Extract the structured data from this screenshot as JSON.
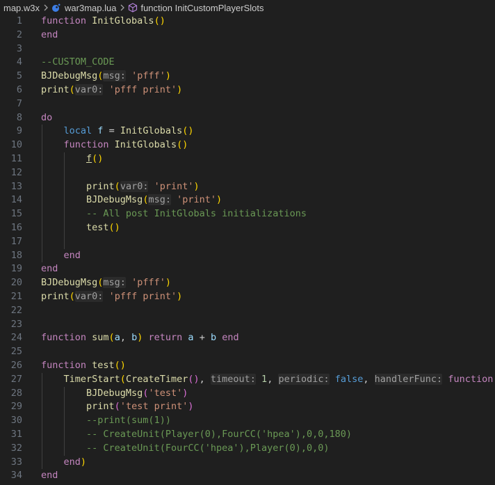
{
  "breadcrumb": {
    "folder": "map.w3x",
    "file": "war3map.lua",
    "symbol": "function InitCustomPlayerSlots"
  },
  "colors": {
    "background": "#1f1f1f",
    "keyword": "#c586c0",
    "function": "#dcdcaa",
    "string": "#ce9178",
    "comment": "#6a9955",
    "variable": "#9cdcfe",
    "number": "#b5cea8",
    "bracket1": "#ffd700",
    "bracket2": "#da70d6",
    "bracket3": "#179fff",
    "hint_bg": "#2b2b2b",
    "line_number": "#6e7681"
  },
  "lines": [
    {
      "n": "1",
      "tokens": [
        [
          "function ",
          "kw"
        ],
        [
          "InitGlobals",
          "fn"
        ],
        [
          "()",
          "b1"
        ]
      ]
    },
    {
      "n": "2",
      "tokens": [
        [
          "end",
          "kw"
        ]
      ]
    },
    {
      "n": "3",
      "tokens": []
    },
    {
      "n": "4",
      "tokens": [
        [
          "--CUSTOM_CODE",
          "cm"
        ]
      ]
    },
    {
      "n": "5",
      "tokens": [
        [
          "BJDebugMsg",
          "fn"
        ],
        [
          "(",
          "b1"
        ],
        [
          "msg:",
          "hint"
        ],
        [
          " ",
          "p"
        ],
        [
          "'pfff'",
          "str"
        ],
        [
          ")",
          "b1"
        ]
      ]
    },
    {
      "n": "6",
      "tokens": [
        [
          "print",
          "fn"
        ],
        [
          "(",
          "b1"
        ],
        [
          "var0:",
          "hint"
        ],
        [
          " ",
          "p"
        ],
        [
          "'pfff print'",
          "str"
        ],
        [
          ")",
          "b1"
        ]
      ]
    },
    {
      "n": "7",
      "tokens": []
    },
    {
      "n": "8",
      "tokens": [
        [
          "do",
          "kw"
        ]
      ]
    },
    {
      "n": "9",
      "tokens": [
        [
          "    ",
          "p"
        ],
        [
          "local ",
          "kw2"
        ],
        [
          "f",
          "var"
        ],
        [
          " = ",
          "p"
        ],
        [
          "InitGlobals",
          "fn"
        ],
        [
          "()",
          "b1"
        ]
      ]
    },
    {
      "n": "10",
      "tokens": [
        [
          "    ",
          "p"
        ],
        [
          "function ",
          "kw"
        ],
        [
          "InitGlobals",
          "fn"
        ],
        [
          "()",
          "b1"
        ]
      ]
    },
    {
      "n": "11",
      "tokens": [
        [
          "        ",
          "p"
        ],
        [
          "f",
          "fnu"
        ],
        [
          "()",
          "b1"
        ]
      ]
    },
    {
      "n": "12",
      "tokens": []
    },
    {
      "n": "13",
      "tokens": [
        [
          "        ",
          "p"
        ],
        [
          "print",
          "fn"
        ],
        [
          "(",
          "b1"
        ],
        [
          "var0:",
          "hint"
        ],
        [
          " ",
          "p"
        ],
        [
          "'print'",
          "str"
        ],
        [
          ")",
          "b1"
        ]
      ]
    },
    {
      "n": "14",
      "tokens": [
        [
          "        ",
          "p"
        ],
        [
          "BJDebugMsg",
          "fn"
        ],
        [
          "(",
          "b1"
        ],
        [
          "msg:",
          "hint"
        ],
        [
          " ",
          "p"
        ],
        [
          "'print'",
          "str"
        ],
        [
          ")",
          "b1"
        ]
      ]
    },
    {
      "n": "15",
      "tokens": [
        [
          "        ",
          "p"
        ],
        [
          "-- All post InitGlobals initializations",
          "cm"
        ]
      ]
    },
    {
      "n": "16",
      "tokens": [
        [
          "        ",
          "p"
        ],
        [
          "test",
          "fn"
        ],
        [
          "()",
          "b1"
        ]
      ]
    },
    {
      "n": "17",
      "tokens": []
    },
    {
      "n": "18",
      "tokens": [
        [
          "    ",
          "p"
        ],
        [
          "end",
          "kw"
        ]
      ]
    },
    {
      "n": "19",
      "tokens": [
        [
          "end",
          "kw"
        ]
      ]
    },
    {
      "n": "20",
      "tokens": [
        [
          "BJDebugMsg",
          "fn"
        ],
        [
          "(",
          "b1"
        ],
        [
          "msg:",
          "hint"
        ],
        [
          " ",
          "p"
        ],
        [
          "'pfff'",
          "str"
        ],
        [
          ")",
          "b1"
        ]
      ]
    },
    {
      "n": "21",
      "tokens": [
        [
          "print",
          "fn"
        ],
        [
          "(",
          "b1"
        ],
        [
          "var0:",
          "hint"
        ],
        [
          " ",
          "p"
        ],
        [
          "'pfff print'",
          "str"
        ],
        [
          ")",
          "b1"
        ]
      ]
    },
    {
      "n": "22",
      "tokens": []
    },
    {
      "n": "23",
      "tokens": []
    },
    {
      "n": "24",
      "tokens": [
        [
          "function ",
          "kw"
        ],
        [
          "sum",
          "fn"
        ],
        [
          "(",
          "b1"
        ],
        [
          "a",
          "var"
        ],
        [
          ", ",
          "p"
        ],
        [
          "b",
          "var"
        ],
        [
          ")",
          "b1"
        ],
        [
          " ",
          "p"
        ],
        [
          "return ",
          "kw"
        ],
        [
          "a",
          "var"
        ],
        [
          " + ",
          "p"
        ],
        [
          "b",
          "var"
        ],
        [
          " ",
          "p"
        ],
        [
          "end",
          "kw"
        ]
      ]
    },
    {
      "n": "25",
      "tokens": []
    },
    {
      "n": "26",
      "tokens": [
        [
          "function ",
          "kw"
        ],
        [
          "test",
          "fn"
        ],
        [
          "()",
          "b1"
        ]
      ]
    },
    {
      "n": "27",
      "tokens": [
        [
          "    ",
          "p"
        ],
        [
          "TimerStart",
          "fn"
        ],
        [
          "(",
          "b1"
        ],
        [
          "CreateTimer",
          "fn"
        ],
        [
          "()",
          "b2"
        ],
        [
          ", ",
          "p"
        ],
        [
          "timeout:",
          "hint"
        ],
        [
          " ",
          "p"
        ],
        [
          "1",
          "num"
        ],
        [
          ", ",
          "p"
        ],
        [
          "periodic:",
          "hint"
        ],
        [
          " ",
          "p"
        ],
        [
          "false",
          "bool"
        ],
        [
          ", ",
          "p"
        ],
        [
          "handlerFunc:",
          "hint"
        ],
        [
          " ",
          "p"
        ],
        [
          "function",
          "kw"
        ],
        [
          "()",
          "b2"
        ]
      ]
    },
    {
      "n": "28",
      "tokens": [
        [
          "        ",
          "p"
        ],
        [
          "BJDebugMsg",
          "fn"
        ],
        [
          "(",
          "b2"
        ],
        [
          "'test'",
          "str"
        ],
        [
          ")",
          "b2"
        ]
      ]
    },
    {
      "n": "29",
      "tokens": [
        [
          "        ",
          "p"
        ],
        [
          "print",
          "fn"
        ],
        [
          "(",
          "b2"
        ],
        [
          "'test print'",
          "str"
        ],
        [
          ")",
          "b2"
        ]
      ]
    },
    {
      "n": "30",
      "tokens": [
        [
          "        ",
          "p"
        ],
        [
          "--print(sum(1))",
          "cm"
        ]
      ]
    },
    {
      "n": "31",
      "tokens": [
        [
          "        ",
          "p"
        ],
        [
          "-- CreateUnit(Player(0),FourCC('hpea'),0,0,180)",
          "cm"
        ]
      ]
    },
    {
      "n": "32",
      "tokens": [
        [
          "        ",
          "p"
        ],
        [
          "-- CreateUnit(FourCC('hpea'),Player(0),0,0)",
          "cm"
        ]
      ]
    },
    {
      "n": "33",
      "tokens": [
        [
          "    ",
          "p"
        ],
        [
          "end",
          "kw"
        ],
        [
          ")",
          "b1"
        ]
      ]
    },
    {
      "n": "34",
      "tokens": [
        [
          "end",
          "kw"
        ]
      ]
    }
  ]
}
